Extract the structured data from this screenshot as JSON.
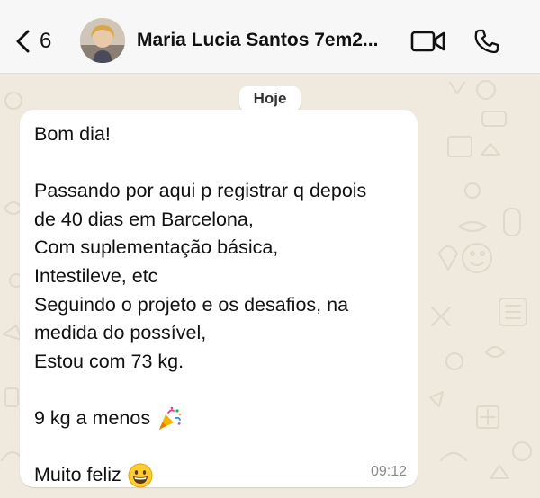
{
  "header": {
    "back_count": "6",
    "contact_name": "Maria Lucia Santos 7em2...",
    "video_icon": "video-camera-icon",
    "phone_icon": "phone-icon"
  },
  "chat": {
    "date_label": "Hoje",
    "message": {
      "lines": [
        "Bom dia!",
        "",
        "Passando por aqui p registrar q depois",
        "de 40 dias em Barcelona,",
        "Com suplementação básica,",
        "Intestileve, etc",
        "Seguindo o projeto e os desafios, na",
        "medida do possível,",
        "Estou com 73 kg.",
        "",
        "9 kg a menos",
        "",
        "Muito feliz"
      ],
      "emoji_party": "party-popper-icon",
      "emoji_smile": "grinning-face-icon",
      "time": "09:12"
    }
  },
  "colors": {
    "header_bg": "#f7f7f7",
    "chat_bg": "#efe9de",
    "bubble_bg": "#ffffff",
    "text": "#111111",
    "timestamp": "#8a8a8a"
  }
}
